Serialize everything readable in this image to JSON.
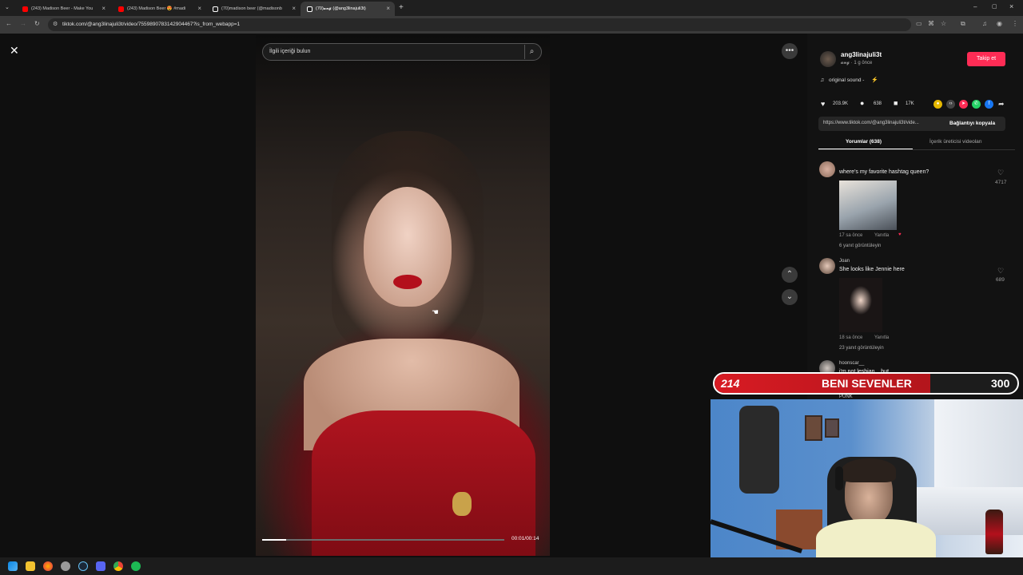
{
  "browser": {
    "tabs": [
      {
        "title": "(243) Madison Beer - Make You",
        "favicon_color": "#ff0000"
      },
      {
        "title": "(243) Madison Beer 😍 #madi",
        "favicon_color": "#ff0000"
      },
      {
        "title": "(70)madison beer (@madisonb",
        "favicon_color": "#ffffff"
      },
      {
        "title": "(70)𝓪𝓷𝓰 (@ang3linajuli3t)",
        "favicon_color": "#ffffff"
      }
    ],
    "url": "tiktok.com/@ang3linajuli3t/video/7559890783142904467?is_from_webapp=1"
  },
  "video": {
    "search_placeholder": "İlgili içeriği bulun",
    "time": "00:01/00:14",
    "progress": 0.1
  },
  "panel": {
    "username": "ang3linajuli3t",
    "subtitle": "𝓪𝓷𝓰 · 1 g önce",
    "follow_label": "Takip et",
    "sound": "original sound -",
    "likes": "203.9K",
    "comments": "638",
    "saves": "17K",
    "link": "https://www.tiktok.com/@ang3linajuli3t/vide...",
    "copy_label": "Bağlantıyı kopyala",
    "tab_comments": "Yorumlar (638)",
    "tab_creator": "İçerik üreticisi videoları",
    "comment_list": [
      {
        "user": "",
        "text": "where's my favorite hashtag queen?",
        "meta_time": "17 sa önce",
        "reply": "Yanıtla",
        "replies": "6 yanıt görüntüleyin",
        "likes": "4717"
      },
      {
        "user": "Joan",
        "text": "She looks like Jennie here",
        "meta_time": "18 sa önce",
        "reply": "Yanıtla",
        "replies": "23 yanıt görüntüleyin",
        "likes": "689"
      },
      {
        "user": "hoonscar__",
        "text": "i'm not lesbian... but",
        "meta_time": "",
        "reply": "",
        "replies": "",
        "likes": ""
      }
    ],
    "partial_user": "PUNK"
  },
  "overlay": {
    "count": "214",
    "label": "BENI SEVENLER",
    "goal": "300",
    "progress": 0.713
  },
  "colors": {
    "follow": "#fe2c55",
    "stream_bar": "#d81b23"
  }
}
